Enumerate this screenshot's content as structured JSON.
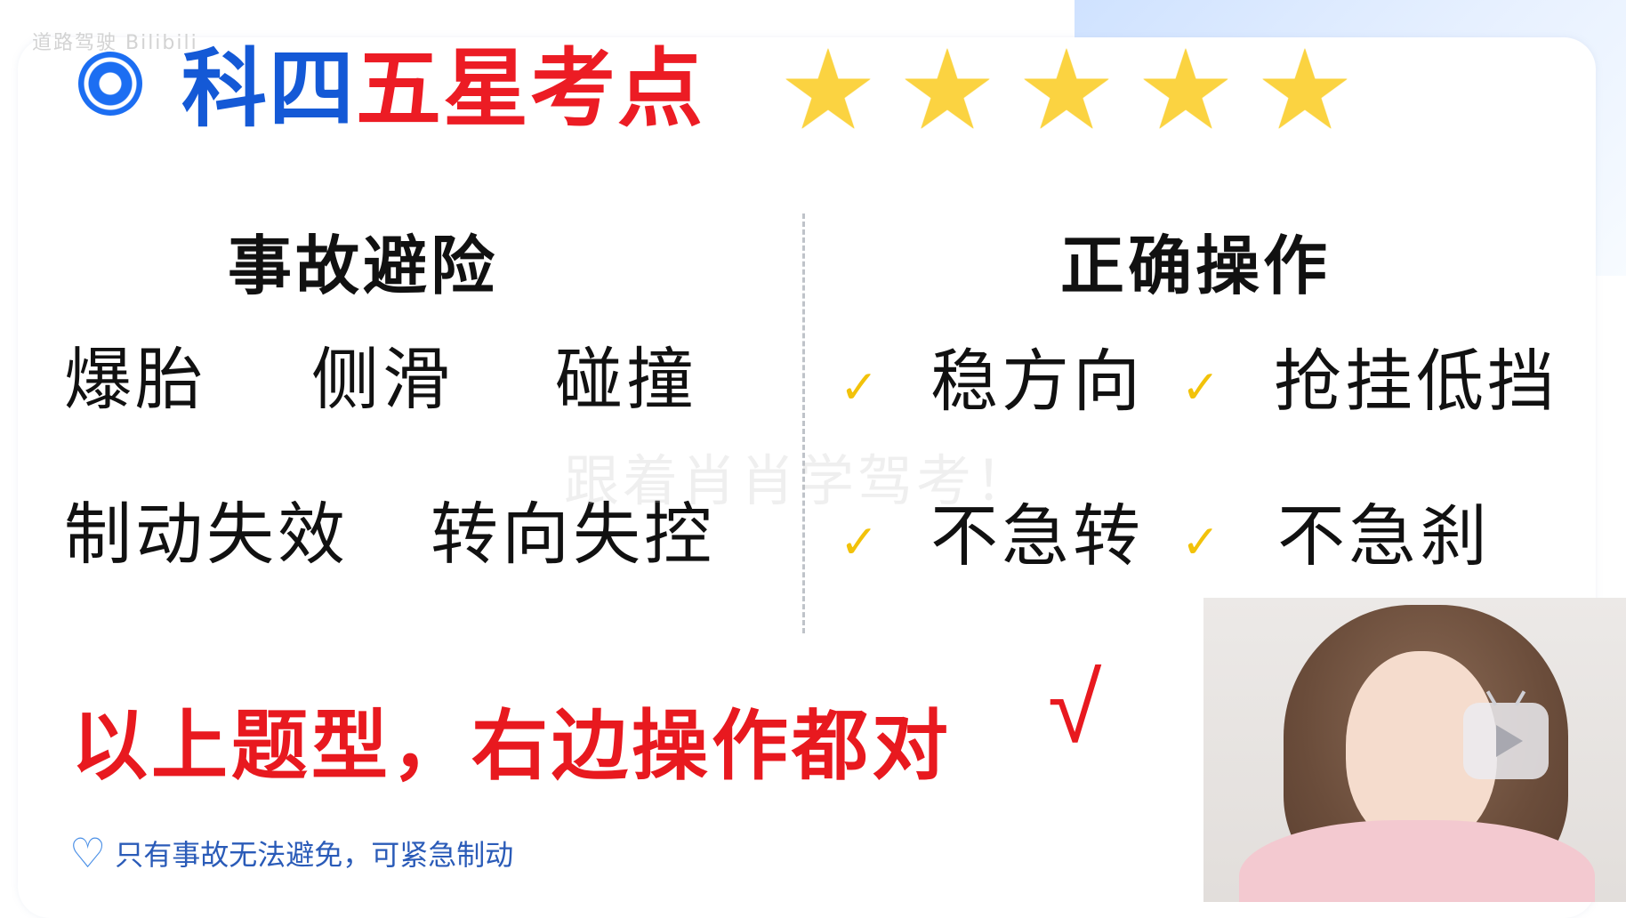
{
  "watermark_top": "道路驾驶 Bilibili",
  "title": {
    "part1": "科四",
    "part2": "五星考点"
  },
  "stars": {
    "count": 5,
    "rating": 5,
    "icon": "star-icon",
    "color": "#fbd341"
  },
  "left_section": {
    "heading": "事故避险",
    "row1": [
      "爆胎",
      "侧滑",
      "碰撞"
    ],
    "row2": [
      "制动失效",
      "转向失控"
    ]
  },
  "right_section": {
    "heading": "正确操作",
    "row1": [
      "稳方向",
      "抢挂低挡"
    ],
    "row2": [
      "不急转",
      "不急刹"
    ]
  },
  "faint_watermark": "跟着肖肖学驾考！",
  "conclusion": "以上题型，右边操作都对",
  "conclusion_mark": "√",
  "note": {
    "icon": "heart-icon",
    "text": "只有事故无法避免，可紧急制动"
  },
  "colors": {
    "blue": "#1459d6",
    "red": "#e8191f",
    "yellow": "#ffe16b",
    "check": "#f2c20a"
  }
}
